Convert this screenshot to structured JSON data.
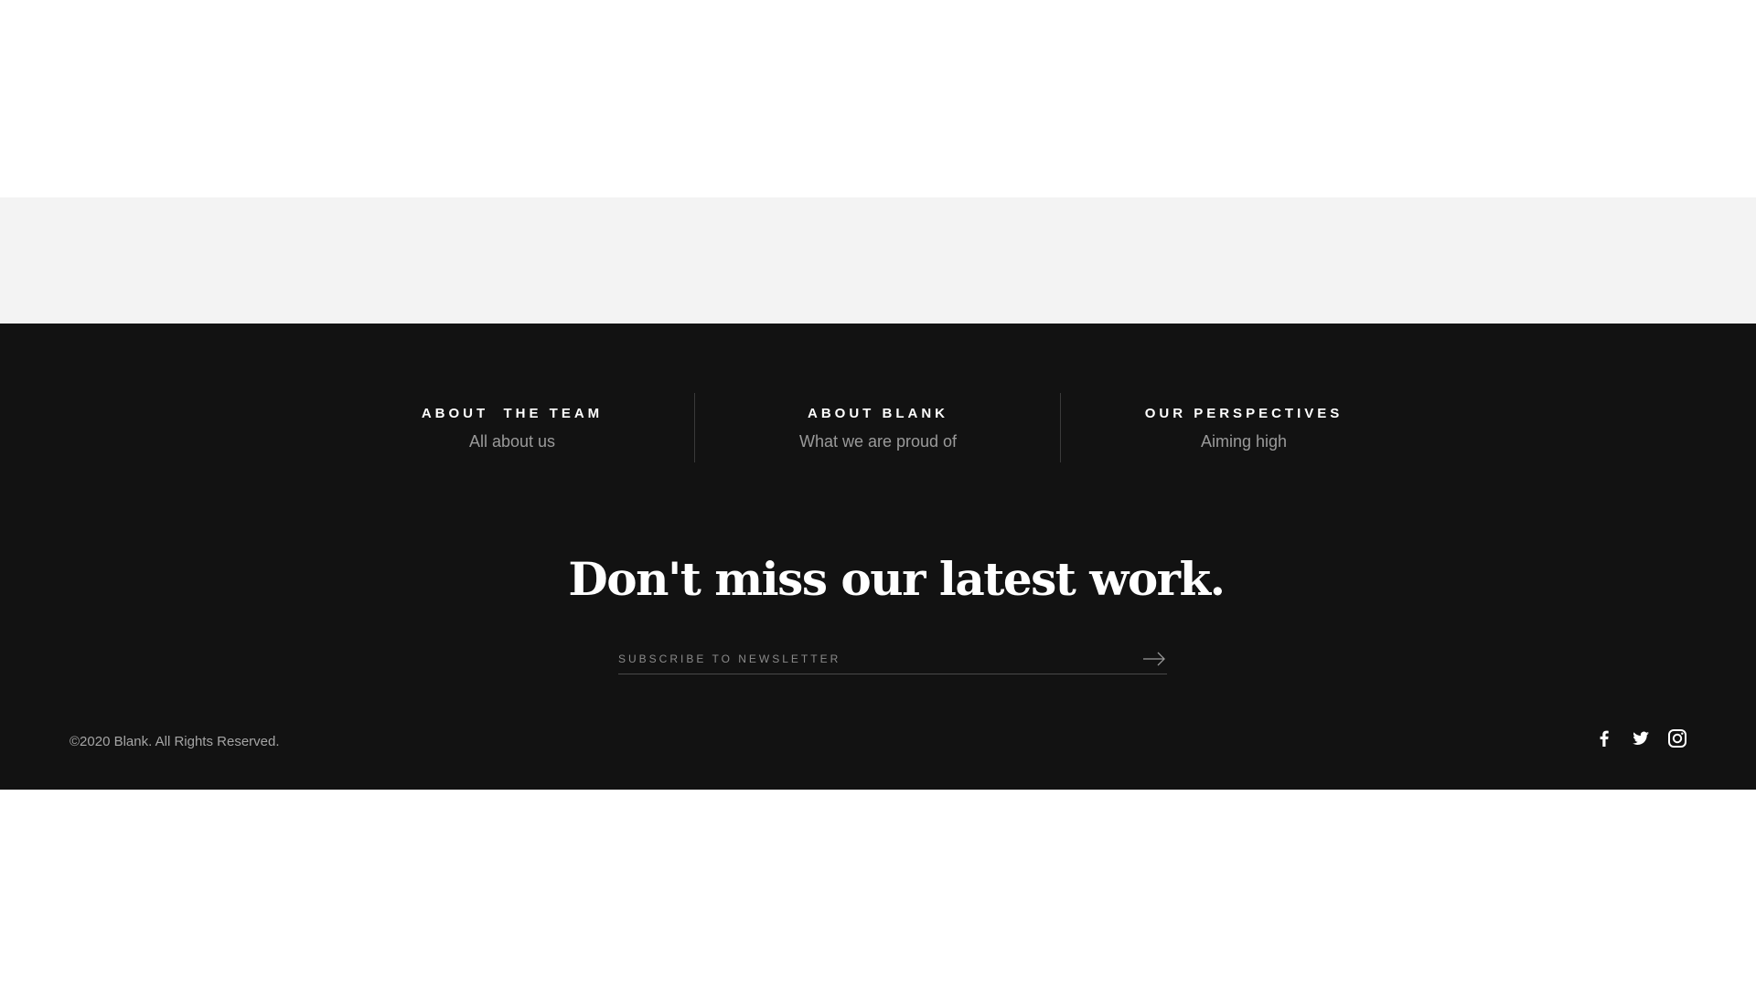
{
  "columns": [
    {
      "title": "ABOUT  THE TEAM",
      "subtitle": "All about us"
    },
    {
      "title": "ABOUT BLANK",
      "subtitle": "What we are proud of"
    },
    {
      "title": "OUR PERSPECTIVES",
      "subtitle": "Aiming high"
    }
  ],
  "newsletter": {
    "headline": "Don't miss our latest work.",
    "placeholder": "SUBSCRIBE TO NEWSLETTER",
    "value": ""
  },
  "footer": {
    "copyright": "©2020 Blank. All Rights Reserved.",
    "social": [
      "facebook-icon",
      "twitter-icon",
      "instagram-icon"
    ]
  },
  "colors": {
    "footer_bg": "#121212",
    "band_bg": "#f3f3f3",
    "text_primary": "#ffffff",
    "text_muted": "#9a9a9a"
  }
}
